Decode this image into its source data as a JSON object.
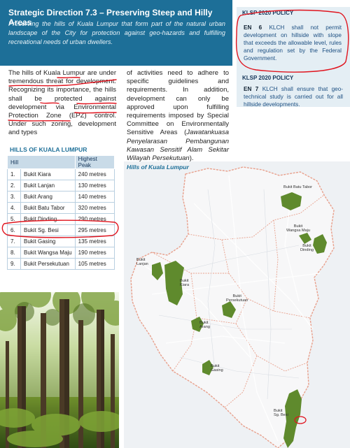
{
  "banner": {
    "title": "Strategic Direction 7.3 – Preserving Steep and Hilly Areas",
    "subtitle": "Preserving the hills of Kuala Lumpur that form part of the natural urban landscape of the City for protection against geo-hazards and fulfilling recreational needs of urban dwellers."
  },
  "policies": [
    {
      "heading": "KLSP 2020 POLICY",
      "code": "EN 6",
      "text": "KLCH shall not permit development on hillside with slope that exceeds the allowable level, rules and regulation set by the Federal Government."
    },
    {
      "heading": "KLSP 2020 POLICY",
      "code": "EN 7",
      "text": "KLCH shall ensure that geo-technical study is carried out for all hillside developments."
    }
  ],
  "body": {
    "col1": "The hills of Kuala Lumpur are under tremendous threat for development. Recognizing its importance, the hills shall be protected against development via Environmental Protection Zone (EPZ) control. Under such zoning, development and types",
    "col2_plain": "of activities need to adhere to specific guidelines and requirements. In addition, development can only be approved upon fulfilling requirements imposed by Special Committee on Environmentally Sensitive Areas (",
    "col2_italic": "Jawatankuasa Penyelarasan Pembangunan Kawasan Sensitif Alam Sekitar Wilayah Persekutuan",
    "col2_end": ")."
  },
  "table": {
    "title": "HILLS OF KUALA LUMPUR",
    "headers": [
      "Hill",
      "Highest Peak"
    ],
    "rows": [
      [
        "1.",
        "Bukit Kiara",
        "240 metres"
      ],
      [
        "2.",
        "Bukit Lanjan",
        "130 metres"
      ],
      [
        "3.",
        "Bukit Arang",
        "140 metres"
      ],
      [
        "4.",
        "Bukit Batu Tabor",
        "320 metres"
      ],
      [
        "5.",
        "Bukit Dinding",
        "290 metres"
      ],
      [
        "6.",
        "Bukit Sg. Besi",
        "295 metres"
      ],
      [
        "7.",
        "Bukit Gasing",
        "135 metres"
      ],
      [
        "8.",
        "Bukit Wangsa Maju",
        "190 metres"
      ],
      [
        "9.",
        "Bukit Persekutuan",
        "105 metres"
      ]
    ]
  },
  "map": {
    "title": "Hills of Kuala Lumpur",
    "labels": {
      "batu_tabor": "Bukit Batu Tabor",
      "wangsa_maju_1": "Bukit",
      "wangsa_maju_2": "Wangsa Maju",
      "dinding_1": "Bukit",
      "dinding_2": "Dinding",
      "lanjan_1": "Bukit",
      "lanjan_2": "Lanjan",
      "kiara_1": "Bukit",
      "kiara_2": "Kiara",
      "persekutuan_1": "Bukit",
      "persekutuan_2": "Persekutuan",
      "arang_1": "Bukit",
      "arang_2": "Arang",
      "gasing_1": "Bukit",
      "gasing_2": "Gasing",
      "sgbesi_1": "Bukit",
      "sgbesi_2": "Sg. Besi"
    }
  },
  "colors": {
    "banner": "#1d6f98",
    "policy_bg": "#e4eef4",
    "hill_green": "#5f8a2d",
    "annotation_red": "#e0141e",
    "boundary": "#e8a08c"
  }
}
